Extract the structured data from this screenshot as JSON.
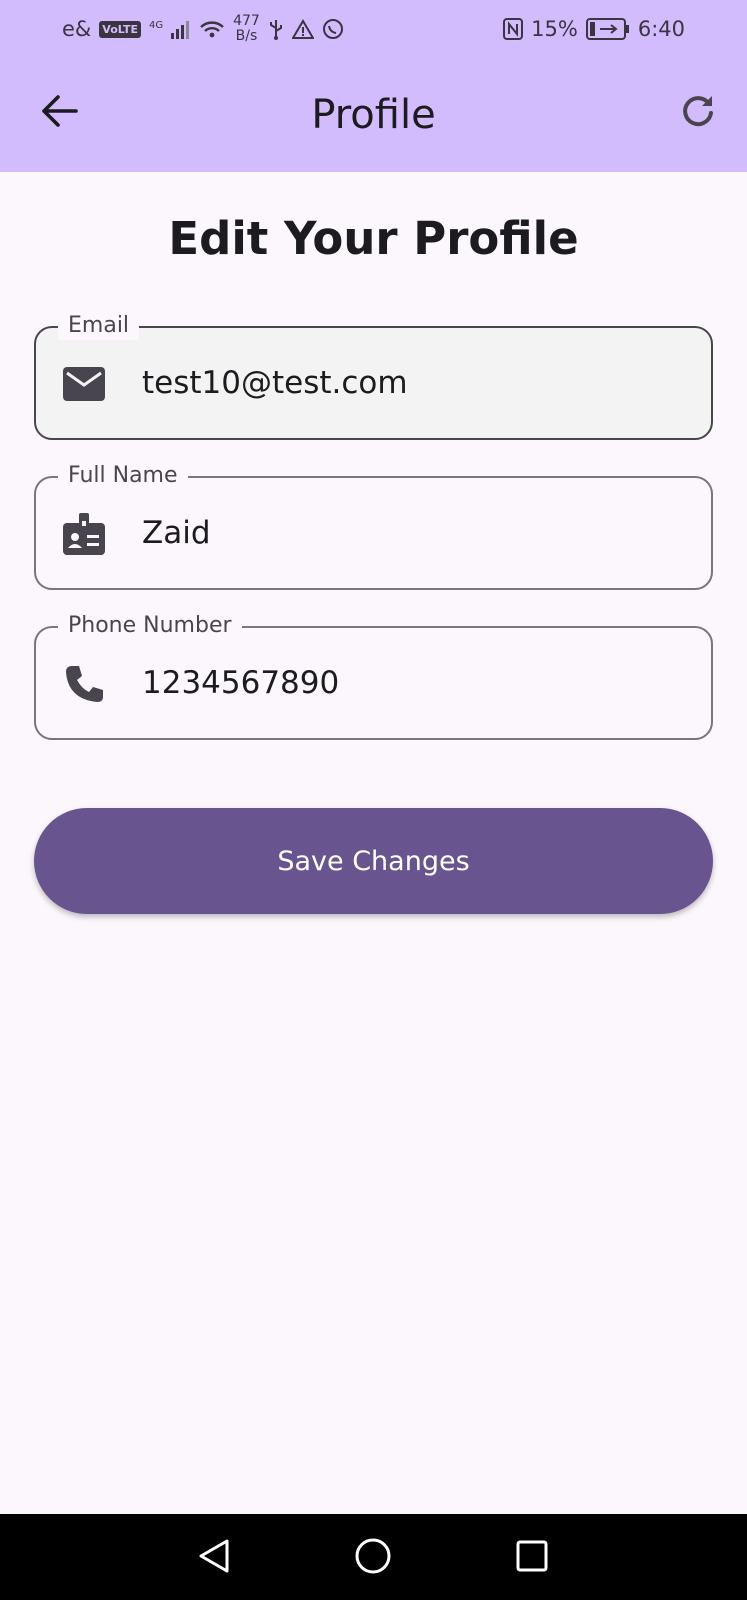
{
  "status_bar": {
    "carrier": "e&",
    "volte": "VoLTE",
    "network": "4G",
    "speed_value": "477",
    "speed_unit": "B/s",
    "battery": "15%",
    "time": "6:40"
  },
  "app_bar": {
    "title": "Profile",
    "back_icon": "arrow-back-icon",
    "refresh_icon": "refresh-icon"
  },
  "page": {
    "heading": "Edit Your Profile"
  },
  "fields": {
    "email": {
      "label": "Email",
      "value": "test10@test.com",
      "icon": "email-icon"
    },
    "full_name": {
      "label": "Full Name",
      "value": "Zaid",
      "icon": "badge-icon"
    },
    "phone": {
      "label": "Phone Number",
      "value": "1234567890",
      "icon": "phone-icon"
    }
  },
  "save_button": {
    "label": "Save Changes"
  },
  "colors": {
    "app_bar": "#d2bcfd",
    "background": "#fcf6fd",
    "primary": "#68548e",
    "nav_bar": "#000000"
  }
}
